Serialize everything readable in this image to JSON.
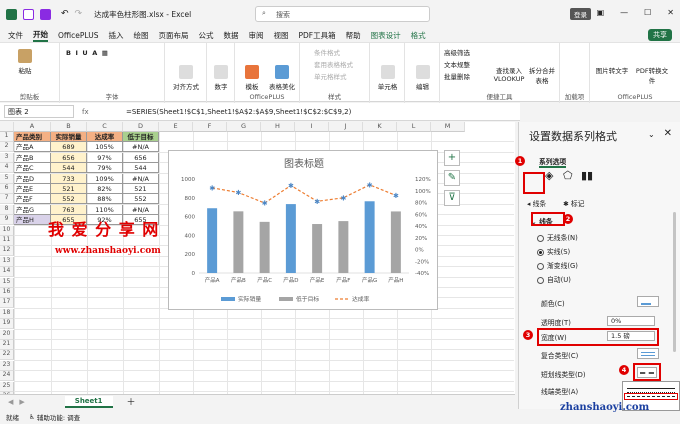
{
  "app": {
    "filename": "达成率色柱形图.xlsx",
    "app_name": "Excel",
    "search_placeholder": "搜索",
    "login_label": "登录",
    "share_label": "共享"
  },
  "menu": [
    "文件",
    "开始",
    "OfficePLUS",
    "插入",
    "绘图",
    "页面布局",
    "公式",
    "数据",
    "审阅",
    "视图",
    "PDF工具箱",
    "帮助",
    "图表设计",
    "格式"
  ],
  "ribbon": {
    "groups": [
      "剪贴板",
      "字体",
      "对齐方式",
      "数字",
      "样式",
      "单元格",
      "编辑",
      "加载项",
      "OfficePLUS",
      "便捷工具",
      "加载项",
      "OfficePLUS"
    ],
    "buttons": {
      "paste": "粘贴",
      "align": "对齐方式",
      "number": "数字",
      "template": "模板",
      "beautify": "表格美化",
      "cond": "条件格式",
      "tablefmt": "套用表格格式",
      "cellstyle": "单元格样式",
      "cells": "单元格",
      "edit": "编辑",
      "adv_filter": "高级筛选",
      "text_conv": "文本规整",
      "batch": "批量删除",
      "lookup": "查找录入 VLOOKUP",
      "split": "拆分合并表格",
      "img_convert": "图片转文字",
      "pdf_convert": "PDF转换文件"
    }
  },
  "formula_bar": {
    "name_box": "图表 2",
    "fx": "fx",
    "formula": "=SERIES(Sheet1!$C$1,Sheet1!$A$2:$A$9,Sheet1!$C$2:$C$9,2)"
  },
  "columns": [
    "A",
    "B",
    "C",
    "D",
    "E",
    "F",
    "G",
    "H",
    "I",
    "J",
    "K",
    "L",
    "M"
  ],
  "rows": [
    "1",
    "2",
    "3",
    "4",
    "5",
    "6",
    "7",
    "8",
    "9",
    "10",
    "11",
    "12",
    "13",
    "14",
    "15",
    "16",
    "17",
    "18",
    "19",
    "20",
    "21",
    "22",
    "23",
    "24",
    "25",
    "26"
  ],
  "table": {
    "headers": [
      "产品类别",
      "实际销量",
      "达成率",
      "低于目标"
    ],
    "rows": [
      [
        "产品A",
        "689",
        "105%",
        "#N/A"
      ],
      [
        "产品B",
        "656",
        "97%",
        "656"
      ],
      [
        "产品C",
        "544",
        "79%",
        "544"
      ],
      [
        "产品D",
        "733",
        "109%",
        "#N/A"
      ],
      [
        "产品E",
        "521",
        "82%",
        "521"
      ],
      [
        "产品F",
        "552",
        "88%",
        "552"
      ],
      [
        "产品G",
        "763",
        "110%",
        "#N/A"
      ],
      [
        "产品H",
        "655",
        "92%",
        "655"
      ]
    ],
    "header_colors": [
      "#f4b084",
      "#f4b084",
      "#f4b084",
      "#a9d08e"
    ]
  },
  "watermark": {
    "line1": "我 爱 分 享 网",
    "line2": "www.zhanshaoyi.com",
    "corner": "zhanshaoyi.com"
  },
  "chart_data": {
    "type": "bar",
    "title": "图表标题",
    "categories": [
      "产品A",
      "产品B",
      "产品C",
      "产品D",
      "产品E",
      "产品F",
      "产品G",
      "产品H"
    ],
    "series": [
      {
        "name": "实际销量",
        "kind": "bar",
        "axis": "left",
        "color": "#5b9bd5",
        "values": [
          689,
          656,
          544,
          733,
          521,
          552,
          763,
          655
        ],
        "colors": [
          "#5b9bd5",
          "#a5a5a5",
          "#a5a5a5",
          "#5b9bd5",
          "#a5a5a5",
          "#a5a5a5",
          "#5b9bd5",
          "#a5a5a5"
        ]
      },
      {
        "name": "低于目标",
        "kind": "bar",
        "axis": "left",
        "color": "#a5a5a5",
        "values": [
          null,
          656,
          544,
          null,
          521,
          552,
          null,
          655
        ]
      },
      {
        "name": "达成率",
        "kind": "line",
        "axis": "right",
        "color": "#ed7d31",
        "dashed": true,
        "values": [
          105,
          97,
          79,
          109,
          82,
          88,
          110,
          92
        ]
      }
    ],
    "ylim": [
      0,
      1000
    ],
    "yticks": [
      "1000",
      "800",
      "600",
      "400",
      "200",
      "0"
    ],
    "y2lim": [
      -40,
      120
    ],
    "y2ticks": [
      "120%",
      "100%",
      "80%",
      "60%",
      "40%",
      "20%",
      "0%",
      "-20%",
      "-40%"
    ],
    "legend_position": "bottom",
    "grid": false
  },
  "chart_tools": [
    "+",
    "✎",
    "⊽"
  ],
  "sheet_tab": "Sheet1",
  "status": {
    "ready": "就绪",
    "accessibility": "辅助功能: 调查"
  },
  "pane": {
    "title": "设置数据系列格式",
    "series_options": "系列选项",
    "tab_line": "线条",
    "tab_marker": "标记",
    "section_line": "线条",
    "radio_options": [
      "无线条(N)",
      "实线(S)",
      "渐变线(G)",
      "自动(U)"
    ],
    "selected_radio": 1,
    "color_label": "颜色(C)",
    "transparency_label": "透明度(T)",
    "transparency_value": "0%",
    "width_label": "宽度(W)",
    "width_value": "1.5 磅",
    "compound_label": "复合类型(C)",
    "dash_label": "短划线类型(D)",
    "cap_label": "线端类型(A)",
    "badges": [
      "1",
      "2",
      "3",
      "4"
    ]
  }
}
